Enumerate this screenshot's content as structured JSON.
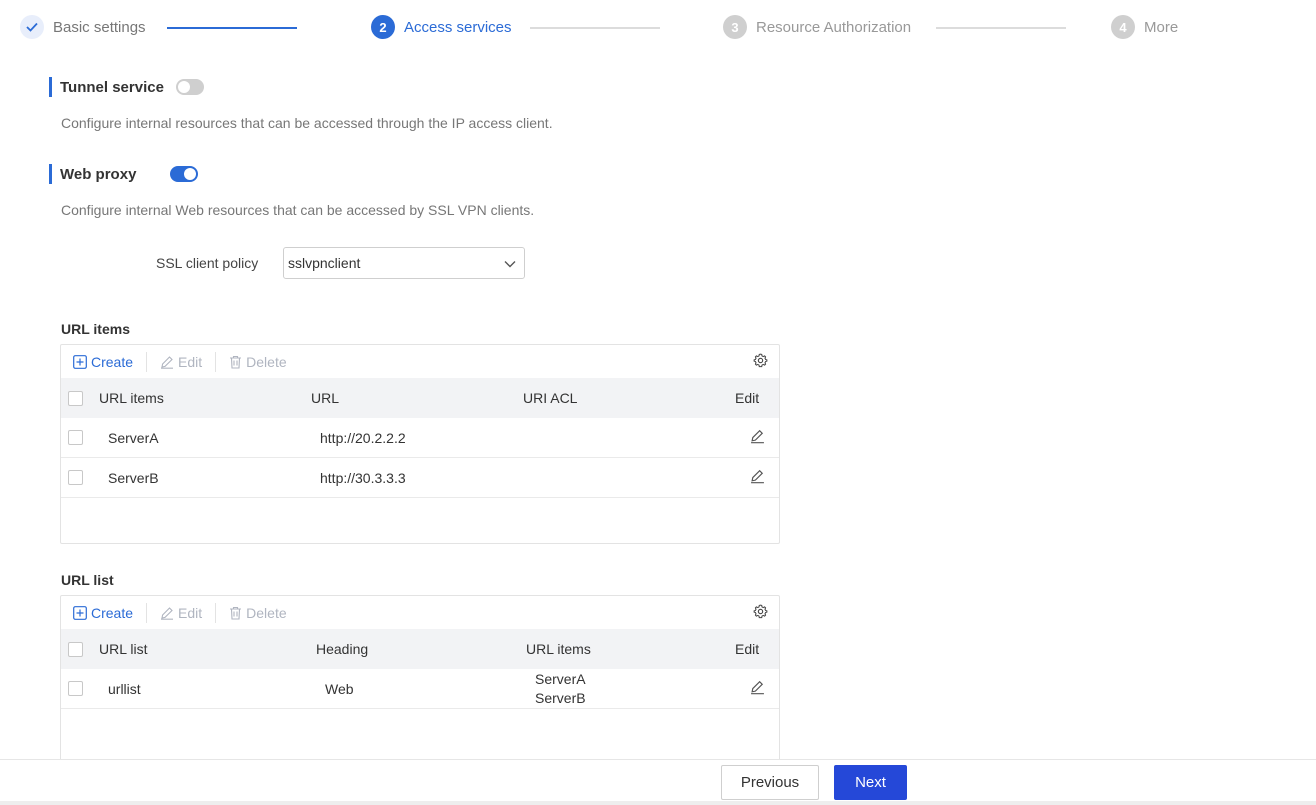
{
  "stepper": {
    "steps": [
      {
        "number": "",
        "label": "Basic settings",
        "state": "done"
      },
      {
        "number": "2",
        "label": "Access services",
        "state": "active"
      },
      {
        "number": "3",
        "label": "Resource Authorization",
        "state": "todo"
      },
      {
        "number": "4",
        "label": "More",
        "state": "todo"
      }
    ]
  },
  "tunnel": {
    "title": "Tunnel service",
    "enabled": false,
    "description": "Configure internal resources that can be accessed through the IP access client."
  },
  "webproxy": {
    "title": "Web proxy",
    "enabled": true,
    "description": "Configure internal Web resources that can be accessed by SSL VPN clients.",
    "ssl_policy_label": "SSL client policy",
    "ssl_policy_value": "sslvpnclient"
  },
  "url_items": {
    "title": "URL items",
    "toolbar": {
      "create": "Create",
      "edit": "Edit",
      "delete": "Delete"
    },
    "columns": [
      "URL items",
      "URL",
      "URI ACL",
      "Edit"
    ],
    "rows": [
      {
        "name": "ServerA",
        "url": "http://20.2.2.2",
        "uri_acl": ""
      },
      {
        "name": "ServerB",
        "url": "http://30.3.3.3",
        "uri_acl": ""
      }
    ]
  },
  "url_list": {
    "title": "URL list",
    "toolbar": {
      "create": "Create",
      "edit": "Edit",
      "delete": "Delete"
    },
    "columns": [
      "URL list",
      "Heading",
      "URL items",
      "Edit"
    ],
    "rows": [
      {
        "name": "urllist",
        "heading": "Web",
        "items": [
          "ServerA",
          "ServerB"
        ]
      }
    ]
  },
  "footer": {
    "previous": "Previous",
    "next": "Next"
  },
  "colors": {
    "accent": "#2b6bd6",
    "next_button": "#2548d8"
  }
}
